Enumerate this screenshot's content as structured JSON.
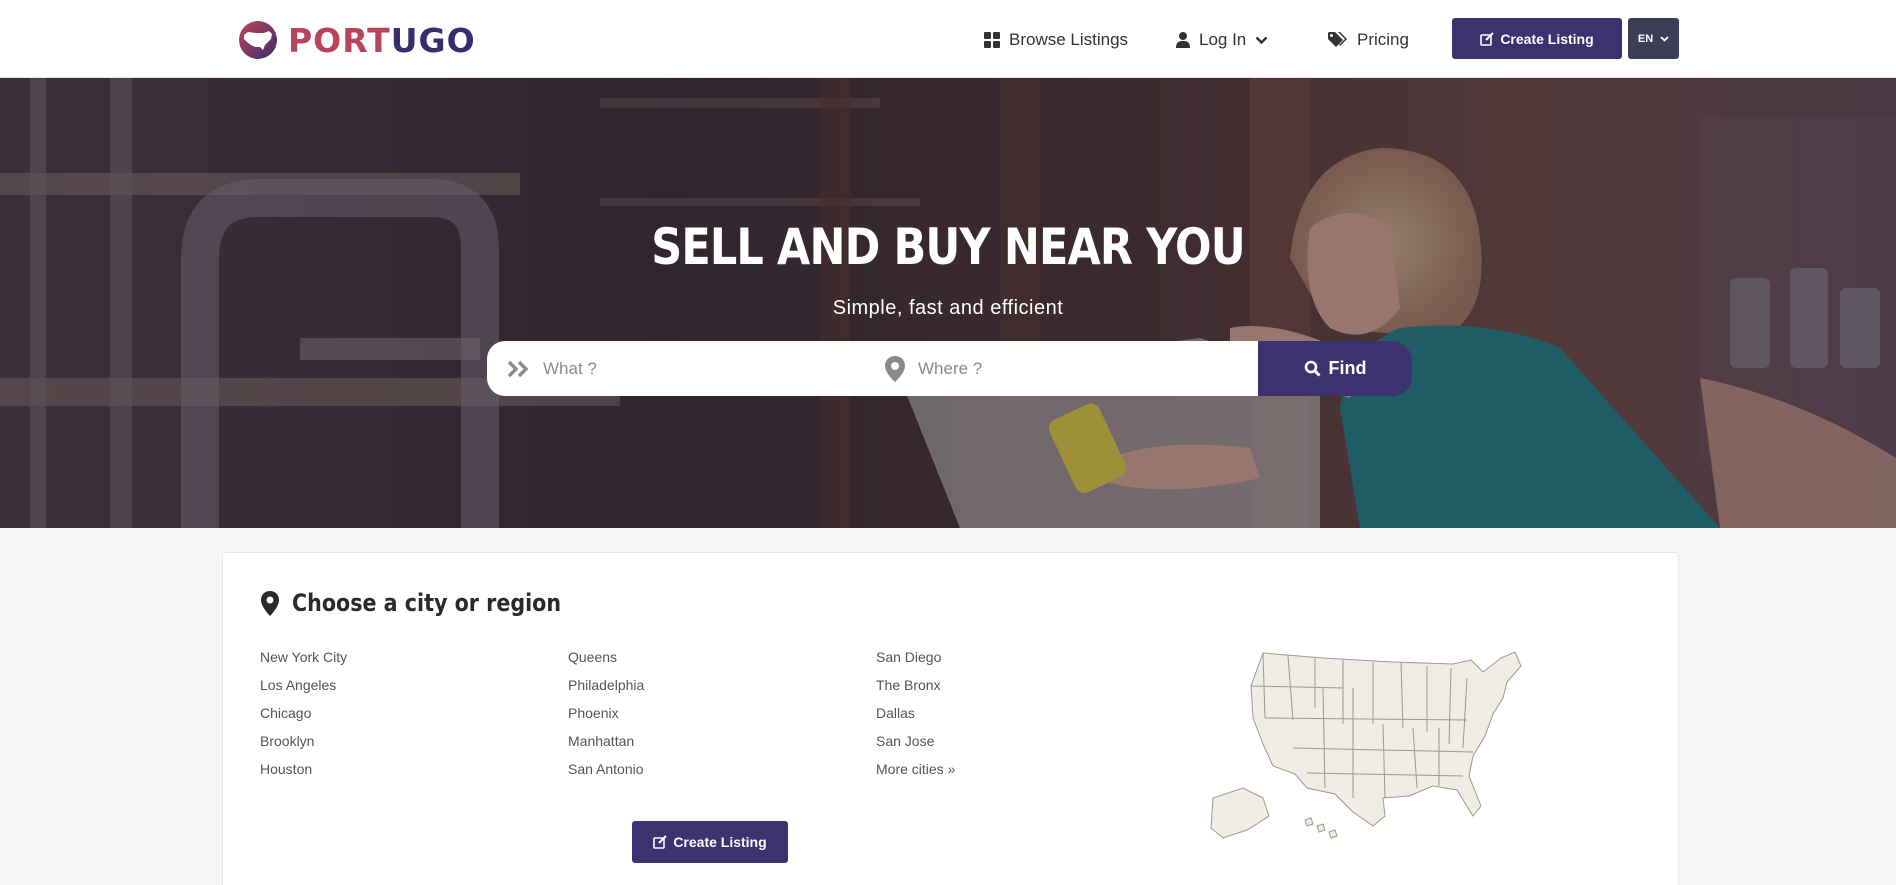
{
  "brand": {
    "name_part1": "PORT",
    "name_part2": "UGO",
    "colors": {
      "primary": "#3b3270",
      "accent": "#b8435a",
      "lang_button": "#3e3d57"
    }
  },
  "nav": {
    "browse_listings": "Browse Listings",
    "log_in": "Log In",
    "pricing": "Pricing",
    "create_listing": "Create Listing",
    "language": "EN"
  },
  "hero": {
    "title": "SELL AND BUY NEAR YOU",
    "subtitle": "Simple, fast and efficient",
    "search": {
      "what_placeholder": "What ?",
      "where_placeholder": "Where ?",
      "find_label": "Find"
    }
  },
  "cities": {
    "title": "Choose a city or region",
    "columns": [
      [
        "New York City",
        "Los Angeles",
        "Chicago",
        "Brooklyn",
        "Houston"
      ],
      [
        "Queens",
        "Philadelphia",
        "Phoenix",
        "Manhattan",
        "San Antonio"
      ],
      [
        "San Diego",
        "The Bronx",
        "Dallas",
        "San Jose",
        "More cities »"
      ]
    ],
    "create_listing": "Create Listing"
  },
  "icons": {
    "logo": "us-map-logo-icon",
    "browse": "grid-icon",
    "login": "user-icon",
    "login_caret": "chevron-down-icon",
    "pricing": "tags-icon",
    "create": "edit-icon",
    "lang_caret": "chevron-down-icon",
    "what": "double-chevron-right-icon",
    "where": "map-marker-icon",
    "find": "search-icon",
    "cities": "map-marker-icon"
  }
}
